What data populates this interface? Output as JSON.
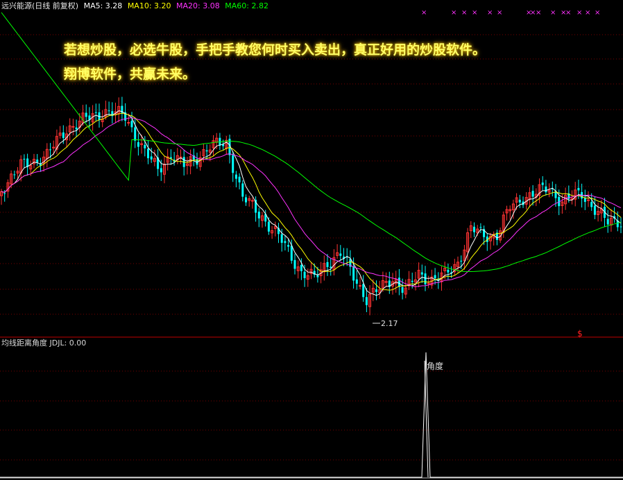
{
  "header": {
    "title": "远兴能源(日线 前复权)",
    "indicators": [
      {
        "label": "MA5: 3.28",
        "color": "#ffffff"
      },
      {
        "label": "MA10: 3.20",
        "color": "#ffff00"
      },
      {
        "label": "MA20: 3.08",
        "color": "#ff33ff"
      },
      {
        "label": "MA60: 2.82",
        "color": "#00ff00"
      }
    ]
  },
  "ad_text": {
    "line1": "若想炒股，必选牛股，手把手教您何时买入卖出，真正好用的炒股软件。",
    "line2": "翔博软件，共赢未来。"
  },
  "annotations": {
    "low_price": "2.17",
    "signal_marker": "$",
    "top_marker": "×",
    "angle_label": "角度"
  },
  "sub_header": {
    "label": "均线距离角度 JDJL: 0.00"
  },
  "colors": {
    "up": "#ff3333",
    "down": "#00ffff",
    "ma5": "#ffffff",
    "ma10": "#ffff00",
    "ma20": "#ff33ff",
    "ma60": "#00ff00",
    "grid": "#7a0000",
    "divider": "#c00000",
    "marker": "#ff33ff"
  },
  "chart_data": {
    "type": "candlestick",
    "series": [
      {
        "name": "MA5"
      },
      {
        "name": "MA10"
      },
      {
        "name": "MA20"
      },
      {
        "name": "MA60"
      }
    ]
  }
}
